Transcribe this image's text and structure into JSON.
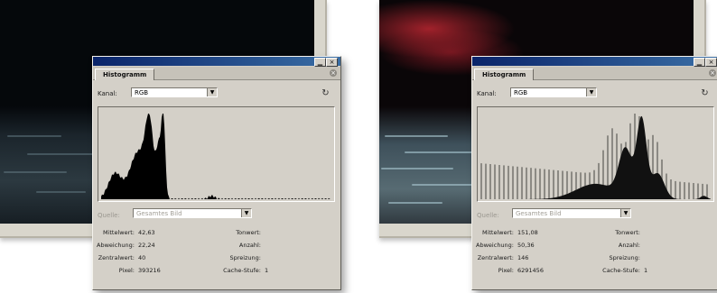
{
  "panels": [
    {
      "tab_label": "Histogramm",
      "kanal_label": "Kanal:",
      "kanal_value": "RGB",
      "quelle_label": "Quelle:",
      "quelle_value": "Gesamtes Bild",
      "stats": {
        "mittelwert_label": "Mittelwert:",
        "mittelwert_value": "42,63",
        "abweichung_label": "Abweichung:",
        "abweichung_value": "22,24",
        "zentralwert_label": "Zentralwert:",
        "zentralwert_value": "40",
        "pixel_label": "Pixel:",
        "pixel_value": "393216",
        "tonwert_label": "Tonwert:",
        "tonwert_value": "",
        "anzahl_label": "Anzahl:",
        "anzahl_value": "",
        "spreizung_label": "Spreizung:",
        "spreizung_value": "",
        "cache_label": "Cache-Stufe:",
        "cache_value": "1"
      },
      "histogram_type": "smooth"
    },
    {
      "tab_label": "Histogramm",
      "kanal_label": "Kanal:",
      "kanal_value": "RGB",
      "quelle_label": "Quelle:",
      "quelle_value": "Gesamtes Bild",
      "stats": {
        "mittelwert_label": "Mittelwert:",
        "mittelwert_value": "151,08",
        "abweichung_label": "Abweichung:",
        "abweichung_value": "50,36",
        "zentralwert_label": "Zentralwert:",
        "zentralwert_value": "146",
        "pixel_label": "Pixel:",
        "pixel_value": "6291456",
        "tonwert_label": "Tonwert:",
        "tonwert_value": "",
        "anzahl_label": "Anzahl:",
        "anzahl_value": "",
        "spreizung_label": "Spreizung:",
        "spreizung_value": "",
        "cache_label": "Cache-Stufe:",
        "cache_value": "1"
      },
      "histogram_type": "combed"
    }
  ],
  "icons": {
    "refresh": "refresh-icon",
    "warning": "warning-icon",
    "close": "close-icon",
    "dropdown": "chevron-down-icon"
  },
  "colors": {
    "panel_bg": "#d4d0c8",
    "titlebar_start": "#0a246a",
    "titlebar_end": "#3a6ea5"
  }
}
